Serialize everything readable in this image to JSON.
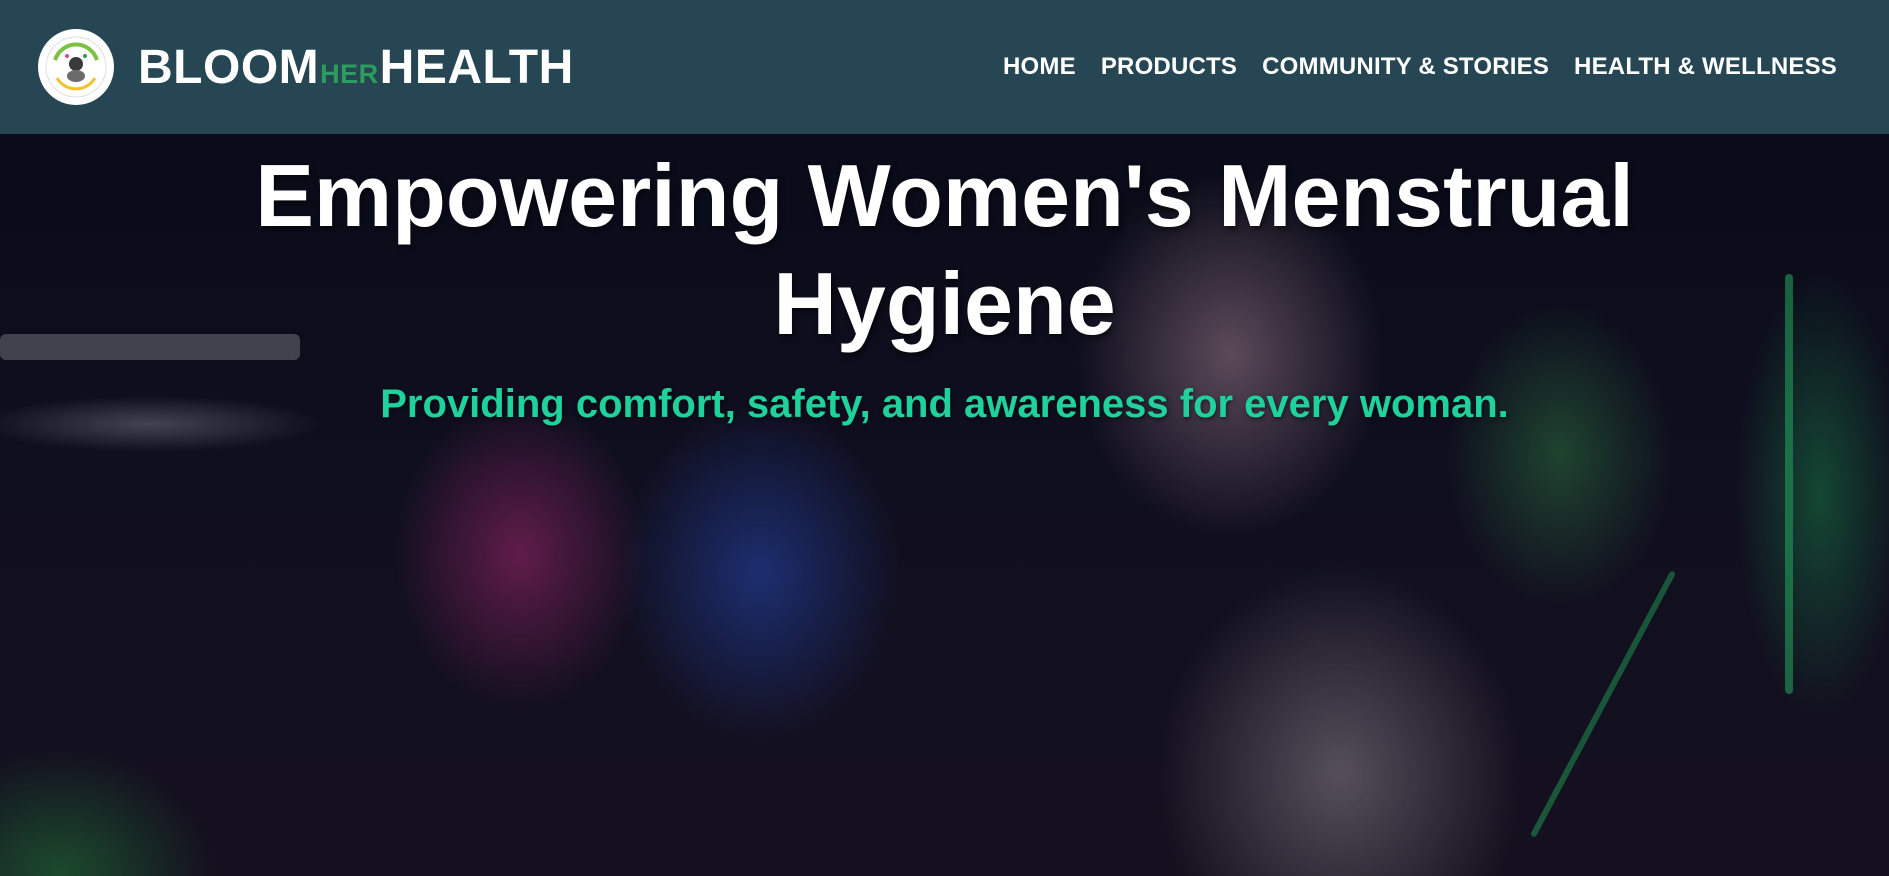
{
  "brand": {
    "part1": "BLOOM",
    "part2": "HER",
    "part3": "HEALTH",
    "logo_icon": "bloom-her-health-logo-icon"
  },
  "nav": {
    "items": [
      {
        "label": "HOME"
      },
      {
        "label": "PRODUCTS"
      },
      {
        "label": "COMMUNITY & STORIES"
      },
      {
        "label": "HEALTH & WELLNESS"
      }
    ]
  },
  "hero": {
    "title": "Empowering Women's Menstrual Hygiene",
    "subtitle": "Providing comfort, safety, and awareness for every woman."
  },
  "colors": {
    "navbar_bg": "#264653",
    "accent_green": "#2a9d5f",
    "subtitle_teal": "#1fd19a",
    "text_white": "#ffffff"
  }
}
